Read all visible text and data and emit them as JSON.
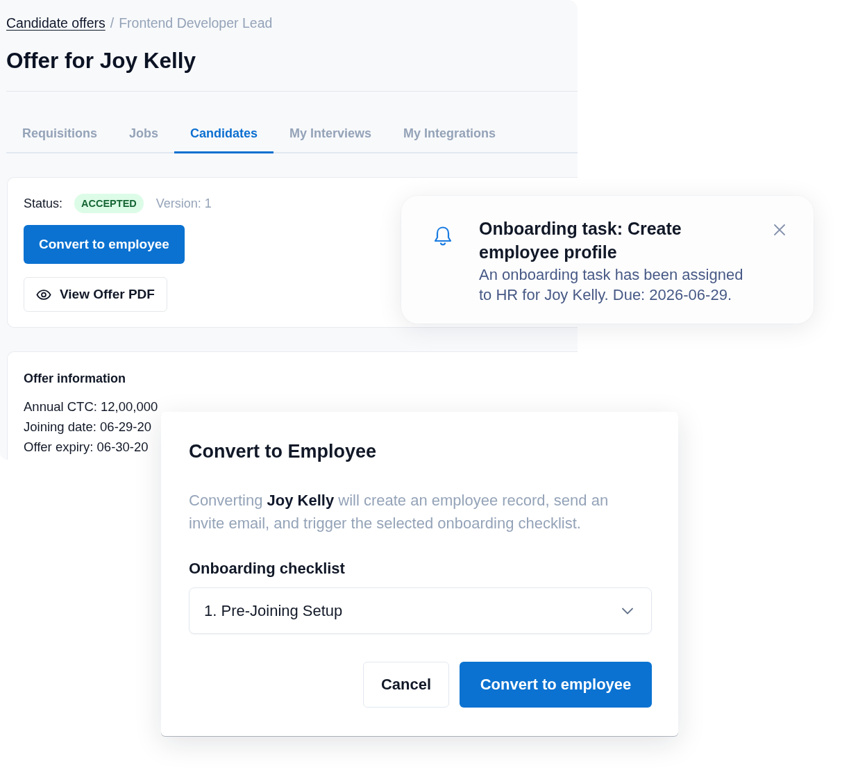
{
  "breadcrumb": {
    "link": "Candidate offers",
    "separator": "/",
    "current": "Frontend Developer Lead"
  },
  "page_title": "Offer for Joy Kelly",
  "tabs": [
    {
      "label": "Requisitions",
      "selected": false
    },
    {
      "label": "Jobs",
      "selected": false
    },
    {
      "label": "Candidates",
      "selected": true
    },
    {
      "label": "My Interviews",
      "selected": false
    },
    {
      "label": "My Integrations",
      "selected": false
    }
  ],
  "status_card": {
    "status_label": "Status:",
    "status": "ACCEPTED",
    "version": "Version: 1",
    "primary_button": "Convert to employee",
    "secondary_button": "View Offer PDF"
  },
  "offer_information": {
    "title": "Offer information",
    "lines": [
      "Annual CTC: 12,00,000",
      "Joining date: 06-29-20",
      "Offer expiry: 06-30-20"
    ]
  },
  "toast": {
    "title": "Onboarding task: Create employee profile",
    "message": "An onboarding task has been assigned to HR for Joy Kelly. Due: 2026-06-29."
  },
  "dialog": {
    "title": "Convert to Employee",
    "message": "Converting **Joy Kelly** will create an employee record, send an invite email, and trigger the selected onboarding checklist.",
    "field_label": "Onboarding checklist",
    "select_value": "1. Pre-Joining Setup",
    "buttons": [
      {
        "label": "Cancel",
        "kind": "secondary"
      },
      {
        "label": "Convert to employee",
        "kind": "primary"
      }
    ]
  }
}
